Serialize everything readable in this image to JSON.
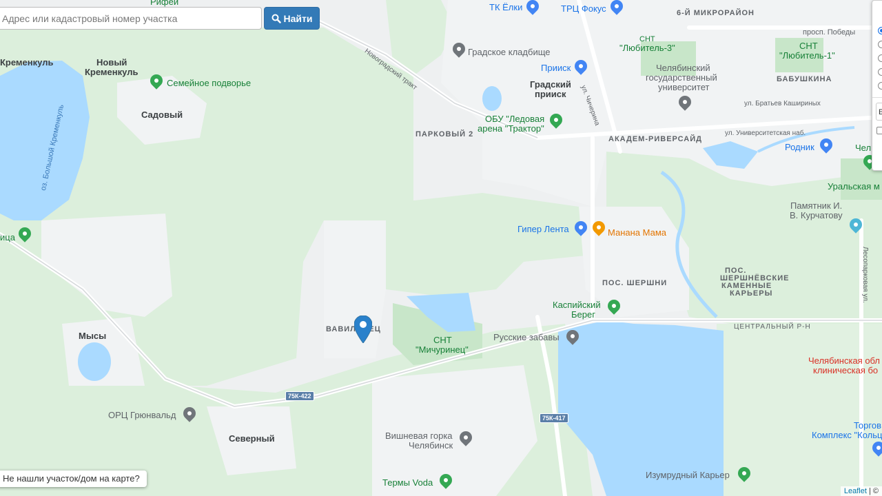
{
  "search": {
    "placeholder": "Адрес или кадастровый номер участка",
    "button_label": "Найти"
  },
  "bottom_hint": "Не нашли участок/дом на карте?",
  "attribution": {
    "leaflet": "Leaflet",
    "separator": "| ©"
  },
  "layer_panel": {
    "options_count": 5,
    "selected_index": 0,
    "checkbox_label": "E"
  },
  "colors": {
    "water": "#aadaff",
    "park": "#c8e6c9",
    "forest": "#dcefdc",
    "urban": "#f1f3f4",
    "road": "#ffffff",
    "button": "#337ab7",
    "marker": "#2a81cb"
  },
  "labels": {
    "rifey": "Рифей",
    "kremenkul": "Кременкуль",
    "novy_kremenkul_1": "Новый",
    "novy_kremenkul_2": "Кременкуль",
    "semeynoe": "Семейное подворье",
    "sadovy": "Садовый",
    "lake_b_kremenkul": "оз. Большой Кременкуль",
    "vavilovets": "ВАВИЛОВЕЦ",
    "mysy": "Мысы",
    "grunwald": "ОРЦ Грюнвальд",
    "severny": "Северный",
    "vishnevaya_1": "Вишневая горка",
    "vishnevaya_2": "Челябинск",
    "termy": "Термы Voda",
    "snt_michurinets_1": "СНТ",
    "snt_michurinets_2": "\"Мичуринец\"",
    "russkie_zabavy": "Русские забавы",
    "kaspiy_1": "Каспийский",
    "kaspiy_2": "Берег",
    "pos_shershni": "ПОС. ШЕРШНИ",
    "giper_lenta": "Гипер Лента",
    "manana": "Манана Мама",
    "parkovy": "ПАРКОВЫЙ 2",
    "gradskoe": "Градское кладбище",
    "tk_elki": "ТК Ёлки",
    "trc_fokus": "ТРЦ Фокус",
    "mkr6": "6-Й МИКРОРАЙОН",
    "snt_lubitel3_1": "СНТ",
    "snt_lubitel3_2": "\"Любитель-3\"",
    "priisk": "Прииск",
    "gradsky_1": "Градский",
    "gradsky_2": "прииск",
    "ul_chicherina": "ул. Чичерина",
    "csu_1": "Челябинский",
    "csu_2": "государственный",
    "csu_3": "университет",
    "prosp_pobedy": "просп. Победы",
    "snt_lubitel1_1": "СНТ",
    "snt_lubitel1_2": "\"Любитель-1\"",
    "babushkina": "БАБУШКИНА",
    "ul_kashirinyh": "ул. Братьев Кашириных",
    "ul_univers": "ул. Университетская наб.",
    "rodnik": "Родник",
    "chel_edge": "Чел",
    "akadem": "АКАДЕМ-РИВЕРСАЙД",
    "arena_1": "ОБУ \"Ледовая",
    "arena_2": "арена \"Трактор\"",
    "novogradsky": "Новоградский тракт",
    "uralskaya": "Уральская м",
    "kurchatov_1": "Памятник И.",
    "kurchatov_2": "В. Курчатову",
    "shershnevskie_1": "ПОС.",
    "shershnevskie_2": "ШЕРШНЁВСКИЕ",
    "shershnevskie_3": "КАМЕННЫЕ",
    "shershnevskie_4": "КАРЬЕРЫ",
    "lesoparkovaya": "Лесопарковая ул.",
    "centralny": "ЦЕНТРАЛЬНЫЙ Р-Н",
    "hospital_1": "Челябинская обл",
    "hospital_2": "клиническая бо",
    "torg_1": "Торгов",
    "torg_2": "Комплекс \"Кольц",
    "izumrudny": "Изумрудный Карьер",
    "road_75k422": "75К-422",
    "road_75k417": "75К-417",
    "lica": "ица"
  }
}
